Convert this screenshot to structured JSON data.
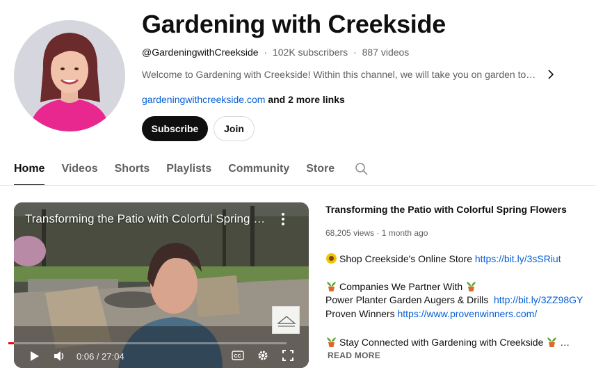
{
  "channel": {
    "title": "Gardening with Creekside",
    "handle": "@GardeningwithCreekside",
    "subscribers": "102K subscribers",
    "videos": "887 videos",
    "description": "Welcome to Gardening with Creekside! Within this channel, we will take you on garden tours, share tips and more",
    "website": "gardeningwithcreekside.com",
    "more_links": "and 2 more links",
    "subscribe_label": "Subscribe",
    "join_label": "Join",
    "meta_separator": "·"
  },
  "tabs": [
    {
      "label": "Home",
      "active": true
    },
    {
      "label": "Videos",
      "active": false
    },
    {
      "label": "Shorts",
      "active": false
    },
    {
      "label": "Playlists",
      "active": false
    },
    {
      "label": "Community",
      "active": false
    },
    {
      "label": "Store",
      "active": false
    }
  ],
  "featured_video": {
    "player_title": "Transforming the Patio with Colorful Spring Flowers",
    "title": "Transforming the Patio with Colorful Spring Flowers",
    "views": "68,205 views",
    "age": "1 month ago",
    "time_display": "0:06 / 27:04",
    "progress_fraction": 0.004,
    "description": {
      "line1_text": "Shop Creekside's Online Store",
      "line1_link": "https://bit.ly/3sSRiut",
      "line2_text": "Companies We Partner With",
      "line3_text": "Power Planter Garden Augers & Drills",
      "line3_link": "http://bit.ly/3ZZ98GY",
      "line4_text": "Proven Winners",
      "line4_link": "https://www.provenwinners.com/",
      "line5_text": "Stay Connected with Gardening with Creekside",
      "line5_suffix": "…"
    },
    "read_more": "READ MORE"
  },
  "colors": {
    "accent_link": "#065fd4",
    "subscribe_bg": "#0f0f0f",
    "progress": "#ff0000",
    "avatar_shirt": "#e8288f"
  },
  "icons": {
    "description_expand": "chevron-right-icon",
    "tab_search": "search-icon",
    "player_menu": "more-vert-icon",
    "play": "play-icon",
    "volume": "volume-icon",
    "captions": "cc-icon",
    "settings": "gear-icon",
    "fullscreen": "fullscreen-icon",
    "sunflower": "sunflower-emoji",
    "potted_plant": "potted-plant-emoji"
  }
}
